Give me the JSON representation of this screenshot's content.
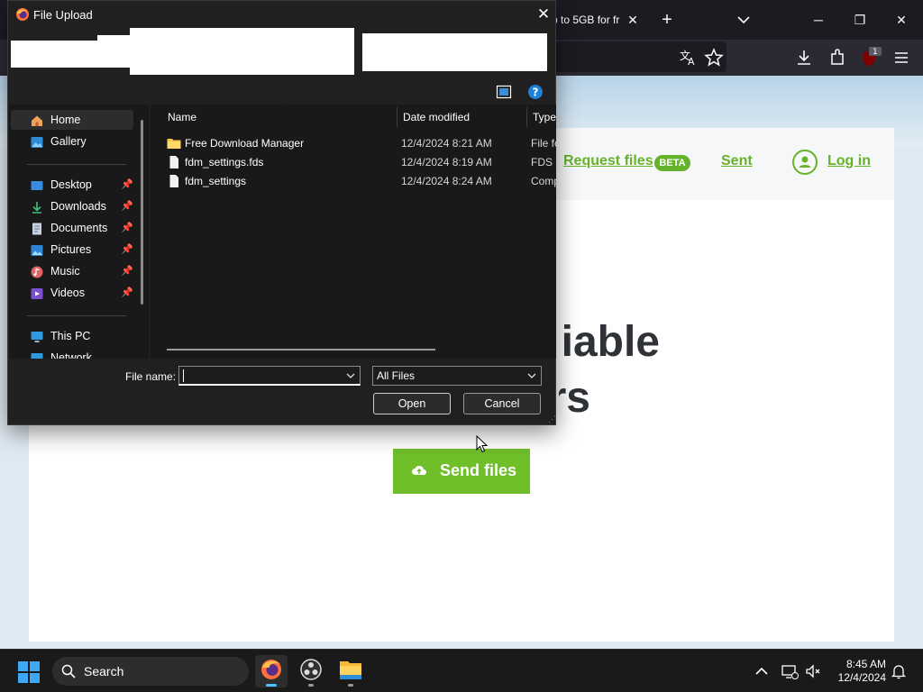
{
  "browser": {
    "tab_title": "p to 5GB for fr",
    "tab_close": "✕",
    "new_tab": "+",
    "window_minimize": "─",
    "window_restore": "❐",
    "window_close": "✕",
    "extension_badge": "1"
  },
  "site": {
    "nav": {
      "request_files": "Request files",
      "beta_badge": "BETA",
      "sent": "Sent",
      "login": "Log in"
    },
    "hero_line1": "iable",
    "hero_line2": "rs",
    "send_button": "Send files",
    "colors": {
      "accent": "#67b22b",
      "button": "#6fbe2a"
    }
  },
  "dialog": {
    "title": "File Upload",
    "close": "✕",
    "nav_pane": {
      "items": [
        {
          "label": "Home",
          "icon": "home-icon",
          "selected": true
        },
        {
          "label": "Gallery",
          "icon": "gallery-icon"
        },
        {
          "label": "Desktop",
          "icon": "desktop-icon",
          "pinned": true
        },
        {
          "label": "Downloads",
          "icon": "download-icon",
          "pinned": true
        },
        {
          "label": "Documents",
          "icon": "documents-icon",
          "pinned": true
        },
        {
          "label": "Pictures",
          "icon": "pictures-icon",
          "pinned": true
        },
        {
          "label": "Music",
          "icon": "music-icon",
          "pinned": true
        },
        {
          "label": "Videos",
          "icon": "videos-icon",
          "pinned": true
        },
        {
          "label": "This PC",
          "icon": "computer-icon"
        },
        {
          "label": "Network",
          "icon": "network-icon"
        }
      ]
    },
    "columns": {
      "name": "Name",
      "date": "Date modified",
      "type": "Type"
    },
    "files": [
      {
        "name": "Free Download Manager",
        "date": "12/4/2024 8:21 AM",
        "type": "File fo",
        "icon": "folder-icon"
      },
      {
        "name": "fdm_settings.fds",
        "date": "12/4/2024 8:19 AM",
        "type": "FDS F",
        "icon": "file-icon"
      },
      {
        "name": "fdm_settings",
        "date": "12/4/2024 8:24 AM",
        "type": "Comp",
        "icon": "file-icon"
      }
    ],
    "file_name_label": "File name:",
    "file_name_value": "",
    "file_type": "All Files",
    "open_button": "Open",
    "cancel_button": "Cancel"
  },
  "taskbar": {
    "search_placeholder": "Search",
    "time": "8:45 AM",
    "date": "12/4/2024",
    "apps": [
      "firefox-icon",
      "obs-icon",
      "file-explorer-icon"
    ]
  }
}
